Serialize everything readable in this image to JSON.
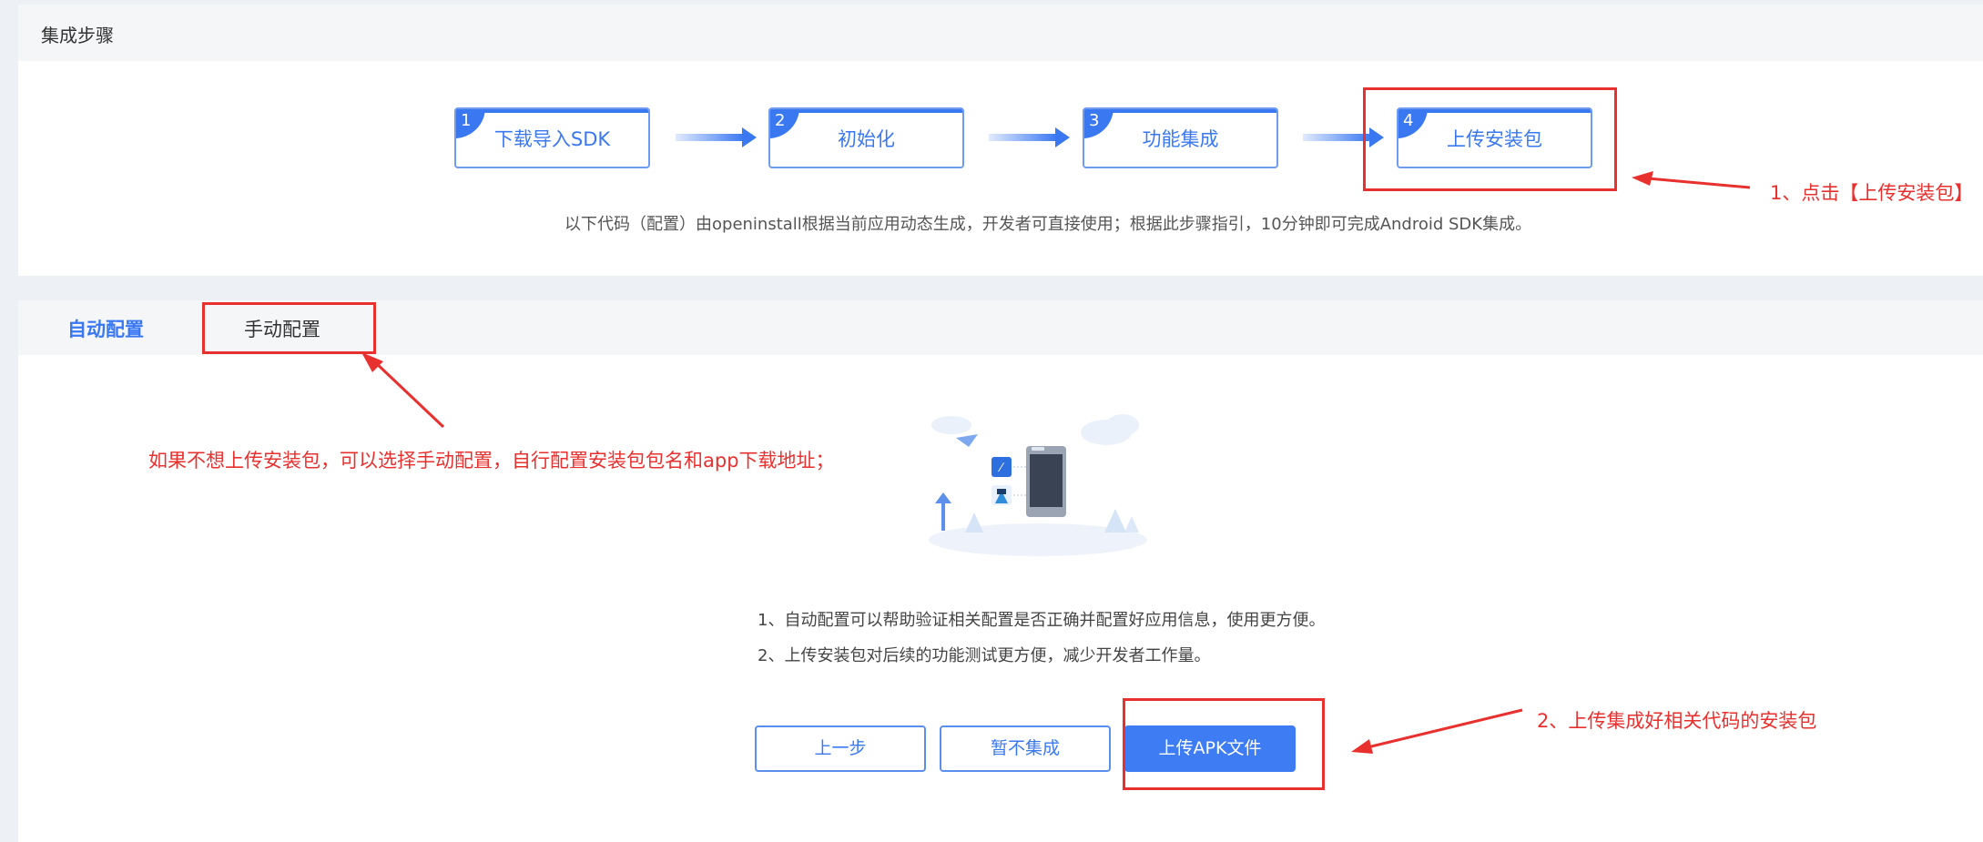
{
  "steps_section": {
    "header": "集成步骤",
    "steps": [
      {
        "num": "1",
        "label": "下载导入SDK"
      },
      {
        "num": "2",
        "label": "初始化"
      },
      {
        "num": "3",
        "label": "功能集成"
      },
      {
        "num": "4",
        "label": "上传安装包"
      }
    ],
    "description": "以下代码（配置）由openinstall根据当前应用动态生成，开发者可直接使用；根据此步骤指引，10分钟即可完成Android SDK集成。"
  },
  "tabs": [
    {
      "label": "自动配置",
      "active": true
    },
    {
      "label": "手动配置",
      "active": false
    }
  ],
  "info_lines": [
    "1、自动配置可以帮助验证相关配置是否正确并配置好应用信息，使用更方便。",
    "2、上传安装包对后续的功能测试更方便，减少开发者工作量。"
  ],
  "buttons": {
    "prev": "上一步",
    "skip": "暂不集成",
    "upload": "上传APK文件"
  },
  "annotations": {
    "note1": "1、点击【上传安装包】",
    "note_manual": "如果不想上传安装包，可以选择手动配置，自行配置安装包包名和app下载地址；",
    "note2": "2、上传集成好相关代码的安装包"
  },
  "colors": {
    "accent": "#3a78f2",
    "annotation_red": "#e8312f",
    "page_bg": "#edf0f4"
  },
  "icons": [
    "phone-illustration-icon",
    "paper-plane-icon",
    "up-arrow-icon",
    "openinstall-app-icon",
    "android-app-icon",
    "cloud-icon"
  ]
}
